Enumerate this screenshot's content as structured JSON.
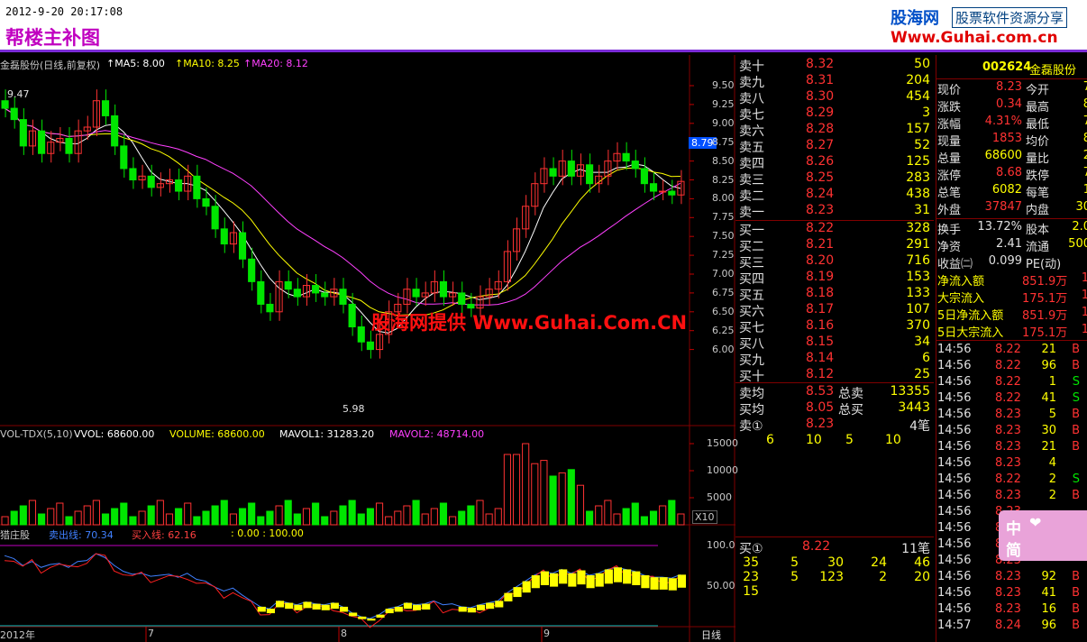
{
  "header": {
    "datetime": "2012-9-20 20:17:08",
    "title": "帮楼主补图",
    "logo_cn": "股海网",
    "logo_slogan": "股票软件资源分享",
    "logo_url": "Www.Guhai.com.cn"
  },
  "watermark": "股海网提供 Www.Guhai.Com.CN",
  "main_chart": {
    "stock_label": "金磊股份(日线,前复权)",
    "ma_legend": [
      {
        "label": "MA5: 8.00",
        "color": "#ffffff"
      },
      {
        "label": "MA10: 8.25",
        "color": "#ffff00"
      },
      {
        "label": "MA20: 8.12",
        "color": "#ff40ff"
      }
    ],
    "price_ticks": [
      "9.50",
      "9.25",
      "9.00",
      "8.75",
      "8.50",
      "8.25",
      "8.00",
      "7.75",
      "7.50",
      "7.25",
      "7.00",
      "6.75",
      "6.50",
      "6.25",
      "6.00"
    ],
    "current_price_tag": "8.79",
    "high_label": "9.47",
    "low_label": "5.98"
  },
  "volume_chart": {
    "indicator": "VOL-TDX(5,10)",
    "vvol": "VVOL: 68600.00",
    "volume": "VOLUME: 68600.00",
    "mavol1": "MAVOL1: 31283.20",
    "mavol2": "MAVOL2: 48714.00",
    "ticks": [
      "15000",
      "10000",
      "5000"
    ],
    "unit": "X10"
  },
  "indicator_chart": {
    "name": "猎庄股",
    "sell_line": "卖出线: 70.34",
    "buy_line": "买入线: 62.16",
    "range": ": 0.00 : 100.00",
    "ticks": [
      "100.0",
      "50.00"
    ]
  },
  "x_axis": {
    "labels": [
      "2012年",
      "7",
      "8",
      "9"
    ],
    "period_btn": "日线"
  },
  "order_book": {
    "asks": [
      {
        "label": "卖十",
        "price": "8.32",
        "qty": "50"
      },
      {
        "label": "卖九",
        "price": "8.31",
        "qty": "204"
      },
      {
        "label": "卖八",
        "price": "8.30",
        "qty": "454"
      },
      {
        "label": "卖七",
        "price": "8.29",
        "qty": "3"
      },
      {
        "label": "卖六",
        "price": "8.28",
        "qty": "157"
      },
      {
        "label": "卖五",
        "price": "8.27",
        "qty": "52"
      },
      {
        "label": "卖四",
        "price": "8.26",
        "qty": "125"
      },
      {
        "label": "卖三",
        "price": "8.25",
        "qty": "283"
      },
      {
        "label": "卖二",
        "price": "8.24",
        "qty": "438"
      },
      {
        "label": "卖一",
        "price": "8.23",
        "qty": "31"
      }
    ],
    "bids": [
      {
        "label": "买一",
        "price": "8.22",
        "qty": "328"
      },
      {
        "label": "买二",
        "price": "8.21",
        "qty": "291"
      },
      {
        "label": "买三",
        "price": "8.20",
        "qty": "716"
      },
      {
        "label": "买四",
        "price": "8.19",
        "qty": "153"
      },
      {
        "label": "买五",
        "price": "8.18",
        "qty": "133"
      },
      {
        "label": "买六",
        "price": "8.17",
        "qty": "107"
      },
      {
        "label": "买七",
        "price": "8.16",
        "qty": "370"
      },
      {
        "label": "买八",
        "price": "8.15",
        "qty": "34"
      },
      {
        "label": "买九",
        "price": "8.14",
        "qty": "6"
      },
      {
        "label": "买十",
        "price": "8.12",
        "qty": "25"
      }
    ],
    "avg_sell": {
      "label": "卖均",
      "price": "8.53",
      "tlabel": "总卖",
      "total": "13355"
    },
    "avg_buy": {
      "label": "买均",
      "price": "8.05",
      "tlabel": "总买",
      "total": "3443"
    },
    "ask1_queue": {
      "label": "卖①",
      "price": "8.23",
      "count": "4笔",
      "values": [
        "6",
        "10",
        "5",
        "10"
      ]
    },
    "bid1_queue": {
      "label": "买①",
      "price": "8.22",
      "count": "11笔",
      "rows": [
        [
          "35",
          "5",
          "30",
          "24",
          "46"
        ],
        [
          "23",
          "5",
          "123",
          "2",
          "20"
        ],
        [
          "15"
        ]
      ]
    }
  },
  "quote": {
    "code": "002624",
    "name": "金磊股份",
    "rows": [
      {
        "l1": "现价",
        "v1": "8.23",
        "l2": "今开",
        "v2": "7"
      },
      {
        "l1": "涨跌",
        "v1": "0.34",
        "l2": "最高",
        "v2": "8"
      },
      {
        "l1": "涨幅",
        "v1": "4.31%",
        "l2": "最低",
        "v2": "7"
      },
      {
        "l1": "现量",
        "v1": "1853",
        "l2": "均价",
        "v2": "8"
      },
      {
        "l1": "总量",
        "v1": "68600",
        "l2": "量比",
        "v2": "2"
      },
      {
        "l1": "涨停",
        "v1": "8.68",
        "l2": "跌停",
        "v2": "7"
      },
      {
        "l1": "总笔",
        "v1": "6082",
        "l2": "每笔",
        "v2": "1"
      },
      {
        "l1": "外盘",
        "v1": "37847",
        "l2": "内盘",
        "v2": "30"
      },
      {
        "l1": "换手",
        "v1": "13.72%",
        "l2": "股本",
        "v2": "2.0"
      },
      {
        "l1": "净资",
        "v1": "2.41",
        "l2": "流通",
        "v2": "500"
      },
      {
        "l1": "收益㈡",
        "v1": "0.099",
        "l2": "PE(动)",
        "v2": ""
      }
    ],
    "flows": [
      {
        "l": "净流入额",
        "v": "851.9万",
        "x": "1"
      },
      {
        "l": "大宗流入",
        "v": "175.1万",
        "x": "1"
      },
      {
        "l": "5日净流入额",
        "v": "851.9万",
        "x": "1"
      },
      {
        "l": "5日大宗流入",
        "v": "175.1万",
        "x": "1"
      }
    ],
    "ticks": [
      {
        "t": "14:56",
        "p": "8.22",
        "v": "21",
        "s": "B"
      },
      {
        "t": "14:56",
        "p": "8.22",
        "v": "96",
        "s": "B"
      },
      {
        "t": "14:56",
        "p": "8.22",
        "v": "1",
        "s": "S"
      },
      {
        "t": "14:56",
        "p": "8.22",
        "v": "41",
        "s": "S"
      },
      {
        "t": "14:56",
        "p": "8.23",
        "v": "5",
        "s": "B"
      },
      {
        "t": "14:56",
        "p": "8.23",
        "v": "30",
        "s": "B"
      },
      {
        "t": "14:56",
        "p": "8.23",
        "v": "21",
        "s": "B"
      },
      {
        "t": "14:56",
        "p": "8.23",
        "v": "4",
        "s": ""
      },
      {
        "t": "14:56",
        "p": "8.22",
        "v": "2",
        "s": "S"
      },
      {
        "t": "14:56",
        "p": "8.23",
        "v": "2",
        "s": "B"
      },
      {
        "t": "14:56",
        "p": "8.23",
        "v": "",
        "s": ""
      },
      {
        "t": "14:56",
        "p": "8.23",
        "v": "",
        "s": ""
      },
      {
        "t": "14:56",
        "p": "8.22",
        "v": "",
        "s": ""
      },
      {
        "t": "14:56",
        "p": "8.23",
        "v": "",
        "s": ""
      },
      {
        "t": "14:56",
        "p": "8.23",
        "v": "92",
        "s": "B"
      },
      {
        "t": "14:56",
        "p": "8.23",
        "v": "41",
        "s": "B"
      },
      {
        "t": "14:56",
        "p": "8.23",
        "v": "16",
        "s": "B"
      },
      {
        "t": "14:57",
        "p": "8.24",
        "v": "96",
        "s": "B"
      }
    ]
  },
  "toolbox": {
    "c1": "中",
    "c2": "简"
  },
  "colors": {
    "up": "#ff3232",
    "down": "#00e600",
    "ma5": "#ffffff",
    "ma10": "#ffff00",
    "ma20": "#ff40ff",
    "grid": "#800000"
  }
}
